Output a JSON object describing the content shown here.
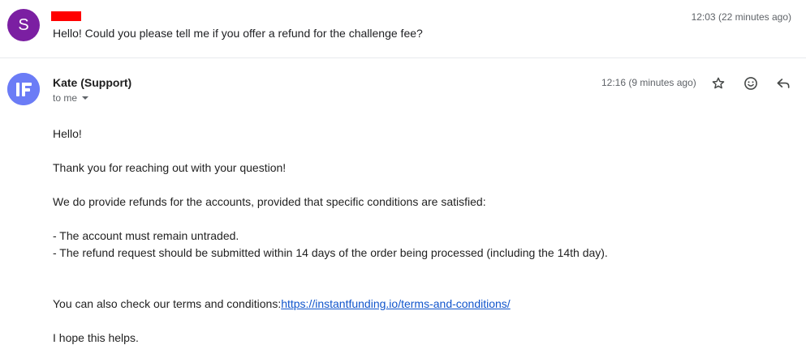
{
  "first_message": {
    "avatar_letter": "S",
    "avatar_color": "#7b1fa2",
    "sender_redaction_color": "#ff0000",
    "time": "12:03 (22 minutes ago)",
    "snippet": "Hello! Could you please tell me if you offer a refund for the challenge fee?"
  },
  "second_message": {
    "avatar_icon": "instantfunding-logo-icon",
    "avatar_color": "#6b7cf6",
    "sender": "Kate (Support)",
    "recipient": "to me",
    "time": "12:16 (9 minutes ago)",
    "actions": [
      "star-icon",
      "emoji-reaction-icon",
      "reply-icon"
    ],
    "body": {
      "greeting": "Hello!",
      "thanks": "Thank you for reaching out with your question!",
      "conditions_intro": "We do provide refunds for the accounts, provided that specific conditions are satisfied:",
      "condition_1": "- The account must remain untraded.",
      "condition_2": "- The refund request should be submitted within 14 days of the order being processed (including the 14th day).",
      "terms_prefix": "You can also check our terms and conditions:",
      "terms_link": "https://instantfunding.io/terms-and-conditions/",
      "closing": "I hope this helps."
    }
  }
}
